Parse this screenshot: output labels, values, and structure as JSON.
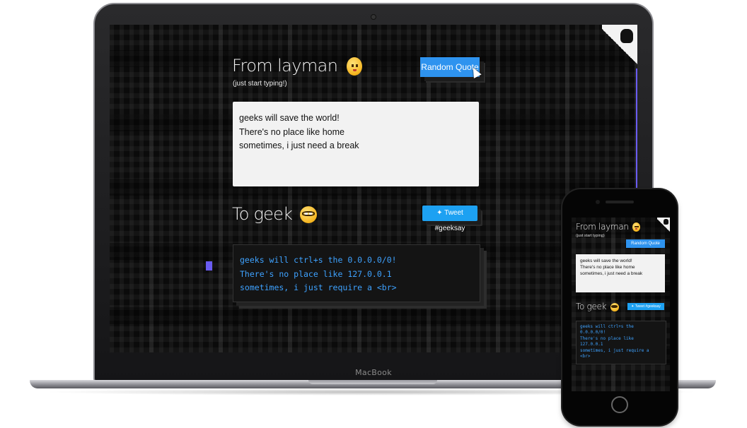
{
  "laptop": {
    "brand": "MacBook",
    "app": {
      "heading1": "From layman",
      "subtitle": "(just start typing!)",
      "random_quote_label": "Random Quote",
      "input_lines": [
        "geeks will save the world!",
        "There's no place like home",
        "sometimes, i just need a break"
      ],
      "heading2": "To geek",
      "tweet_label": "Tweet #geeksay",
      "output_lines": [
        "geeks will ctrl+s the 0.0.0.0/0!",
        "There's no place like 127.0.0.1",
        "sometimes, i just require a <br>"
      ]
    }
  },
  "phone": {
    "app": {
      "heading1": "From layman",
      "subtitle": "(just start typing)",
      "random_quote_label": "Random Quote",
      "input_lines": [
        "geeks will save the world!",
        "There's no place like home",
        "sometimes, i just need a break"
      ],
      "heading2": "To geek",
      "tweet_label": "Tweet #geeksay",
      "output_lines": [
        "geeks will ctrl+s the",
        "0.0.0.0/0!",
        "There's no place like",
        "127.0.0.1",
        "sometimes, i just require a",
        "<br>"
      ]
    }
  },
  "colors": {
    "accent_button": "#2e93ef",
    "tweet_button": "#1da1f2",
    "code_text": "#3ea2ff",
    "marker": "#6a5cf2"
  },
  "icons": {
    "heading1_emoji": "baby-face-icon",
    "heading2_emoji": "nerd-face-icon",
    "tweet_icon": "twitter-bird-icon",
    "corner_icon": "github-octocat-icon",
    "pointer": "mouse-pointer-icon"
  }
}
